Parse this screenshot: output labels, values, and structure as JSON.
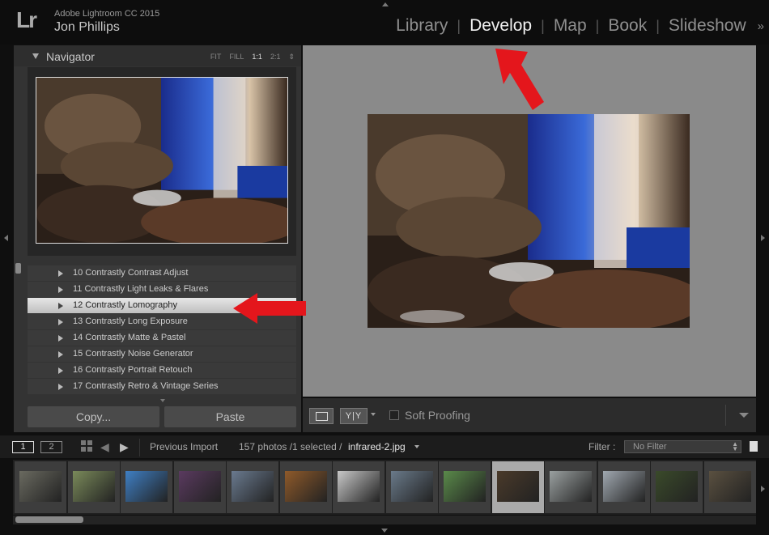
{
  "app": {
    "name": "Adobe Lightroom CC 2015",
    "user": "Jon Phillips",
    "logo": "Lr"
  },
  "modules": [
    {
      "label": "Library",
      "active": false
    },
    {
      "label": "Develop",
      "active": true
    },
    {
      "label": "Map",
      "active": false
    },
    {
      "label": "Book",
      "active": false
    },
    {
      "label": "Slideshow",
      "active": false
    }
  ],
  "modules_more": "»",
  "navigator": {
    "title": "Navigator",
    "zoom_options": [
      "FIT",
      "FILL",
      "1:1",
      "2:1"
    ],
    "zoom_stepper": "⇕"
  },
  "presets": [
    {
      "label": "10 Contrastly Contrast Adjust",
      "selected": false
    },
    {
      "label": "11 Contrastly Light Leaks & Flares",
      "selected": false
    },
    {
      "label": "12 Contrastly Lomography",
      "selected": true
    },
    {
      "label": "13 Contrastly Long Exposure",
      "selected": false
    },
    {
      "label": "14 Contrastly Matte & Pastel",
      "selected": false
    },
    {
      "label": "15 Contrastly Noise Generator",
      "selected": false
    },
    {
      "label": "16 Contrastly Portrait Retouch",
      "selected": false
    },
    {
      "label": "17 Contrastly Retro & Vintage Series",
      "selected": false
    }
  ],
  "buttons": {
    "copy": "Copy...",
    "paste": "Paste"
  },
  "toolbar": {
    "yy": "Y|Y",
    "soft_proofing": "Soft Proofing"
  },
  "filmbar": {
    "screen1": "1",
    "screen2": "2",
    "source": "Previous Import",
    "count": "157 photos /1 selected /",
    "file": "infrared-2.jpg",
    "filter_label": "Filter :",
    "filter_value": "No Filter"
  },
  "filmstrip": {
    "selected_index": 9,
    "thumbs": [
      "#6a6a60",
      "#7a8a5a",
      "#3f7fc4",
      "#5a3a5f",
      "#6a7a8f",
      "#8f5a2a",
      "#c8c8c8",
      "#6a7a8a",
      "#5a8a4a",
      "#4a3a2a",
      "#9aa0a0",
      "#a0a8b0",
      "#3a4a2a",
      "#5a5040"
    ]
  }
}
